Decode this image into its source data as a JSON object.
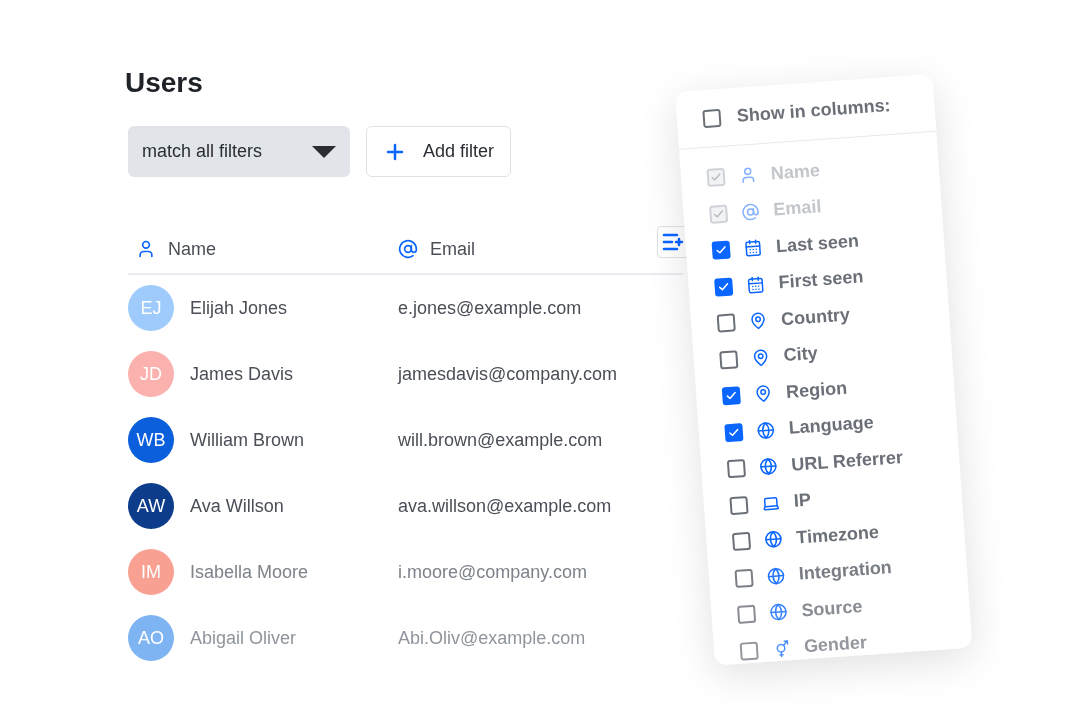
{
  "page": {
    "title": "Users"
  },
  "filter_bar": {
    "match_select": "match all filters",
    "add_button": "Add filter"
  },
  "table": {
    "columns": [
      {
        "label": "Name",
        "kind": "person"
      },
      {
        "label": "Email",
        "kind": "at"
      }
    ],
    "rows": [
      {
        "initials": "EJ",
        "color": "#9ecbfb",
        "name": "Elijah Jones",
        "email": "e.jones@example.com"
      },
      {
        "initials": "JD",
        "color": "#fbb1ae",
        "name": "James Davis",
        "email": "jamesdavis@company.com"
      },
      {
        "initials": "WB",
        "color": "#0b5fdc",
        "name": "William Brown",
        "email": "will.brown@example.com"
      },
      {
        "initials": "AW",
        "color": "#0c3c8a",
        "name": "Ava Willson",
        "email": "ava.willson@example.com"
      },
      {
        "initials": "IM",
        "color": "#f8a192",
        "name": "Isabella Moore",
        "email": "i.moore@company.com"
      },
      {
        "initials": "AO",
        "color": "#7fb4f2",
        "name": "Abigail Oliver",
        "email": "Abi.Oliv@example.com"
      }
    ]
  },
  "columns_menu": {
    "header": {
      "label": "Show in columns:",
      "checked": false
    },
    "items": [
      {
        "label": "Name",
        "kind": "person",
        "checked": true,
        "disabled": true
      },
      {
        "label": "Email",
        "kind": "at",
        "checked": true,
        "disabled": true
      },
      {
        "label": "Last seen",
        "kind": "calendar",
        "checked": true,
        "disabled": false
      },
      {
        "label": "First seen",
        "kind": "calendar",
        "checked": true,
        "disabled": false
      },
      {
        "label": "Country",
        "kind": "pin",
        "checked": false,
        "disabled": false
      },
      {
        "label": "City",
        "kind": "pin",
        "checked": false,
        "disabled": false
      },
      {
        "label": "Region",
        "kind": "pin",
        "checked": true,
        "disabled": false
      },
      {
        "label": "Language",
        "kind": "globe",
        "checked": true,
        "disabled": false
      },
      {
        "label": "URL Referrer",
        "kind": "globe",
        "checked": false,
        "disabled": false
      },
      {
        "label": "IP",
        "kind": "laptop",
        "checked": false,
        "disabled": false
      },
      {
        "label": "Timezone",
        "kind": "globe",
        "checked": false,
        "disabled": false
      },
      {
        "label": "Integration",
        "kind": "globe",
        "checked": false,
        "disabled": false
      },
      {
        "label": "Source",
        "kind": "globe",
        "checked": false,
        "disabled": false
      },
      {
        "label": "Gender",
        "kind": "gender",
        "checked": false,
        "disabled": false
      }
    ]
  }
}
